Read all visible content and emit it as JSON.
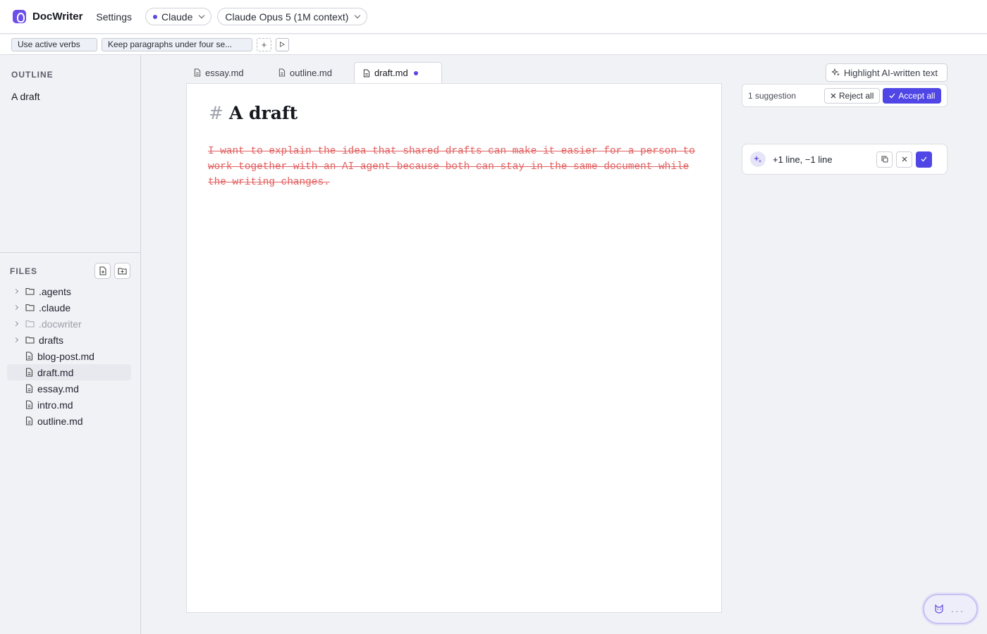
{
  "app": {
    "name": "DocWriter",
    "settings_label": "Settings"
  },
  "header": {
    "provider": "Claude",
    "model": "Claude Opus 5 (1M context)"
  },
  "rules": [
    "Use active verbs",
    "Keep paragraphs under four se..."
  ],
  "rules_add_label": "+",
  "sidebar": {
    "outline_heading": "OUTLINE",
    "outline_items": [
      "A draft"
    ],
    "files_heading": "FILES",
    "files": [
      {
        "name": ".agents",
        "type": "folder"
      },
      {
        "name": ".claude",
        "type": "folder"
      },
      {
        "name": ".docwriter",
        "type": "folder",
        "muted": true
      },
      {
        "name": "drafts",
        "type": "folder"
      },
      {
        "name": "blog-post.md",
        "type": "file"
      },
      {
        "name": "draft.md",
        "type": "file",
        "active": true
      },
      {
        "name": "essay.md",
        "type": "file"
      },
      {
        "name": "intro.md",
        "type": "file"
      },
      {
        "name": "outline.md",
        "type": "file"
      }
    ]
  },
  "tabs": [
    {
      "label": "essay.md"
    },
    {
      "label": "outline.md"
    },
    {
      "label": "draft.md",
      "active": true,
      "modified": true
    }
  ],
  "editor": {
    "heading_marker": "#",
    "title": "A draft",
    "deleted_text": "I want to explain the idea that shared drafts can make it easier for a person to work together with an AI agent because both can stay in the same document while the writing changes."
  },
  "review": {
    "highlight_label": "Highlight AI-written text",
    "suggestion_count": "1 suggestion",
    "reject_all": "Reject all",
    "accept_all": "Accept all",
    "change_summary": "+1 line, −1 line"
  },
  "assistant": {
    "status": "..."
  },
  "colors": {
    "accent": "#4f46e5",
    "deleted": "#e26060",
    "brand": "#6d4ee8"
  }
}
